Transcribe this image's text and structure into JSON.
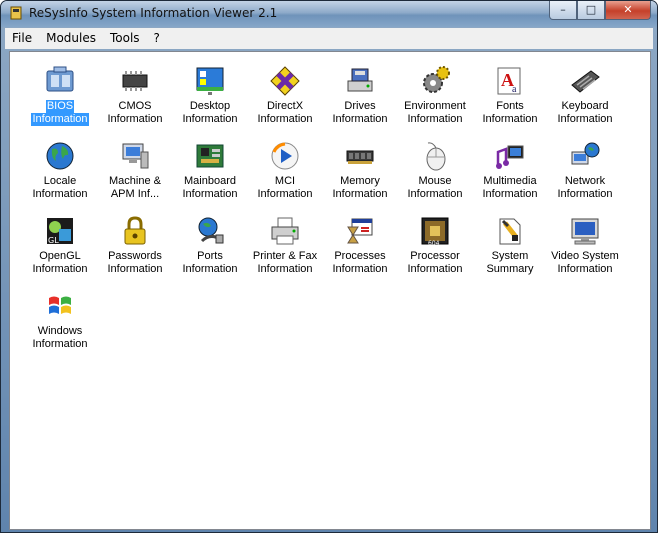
{
  "window": {
    "title": "ReSysInfo System Information Viewer 2.1",
    "minimize": "–",
    "maximize": "□",
    "close": "✕"
  },
  "menu": [
    "File",
    "Modules",
    "Tools",
    "?"
  ],
  "modules": [
    {
      "line1": "BIOS",
      "line2": "Information",
      "icon": "bios-icon"
    },
    {
      "line1": "CMOS",
      "line2": "Information",
      "icon": "chip-icon"
    },
    {
      "line1": "Desktop",
      "line2": "Information",
      "icon": "desktop-icon"
    },
    {
      "line1": "DirectX",
      "line2": "Information",
      "icon": "directx-icon"
    },
    {
      "line1": "Drives",
      "line2": "Information",
      "icon": "drives-icon"
    },
    {
      "line1": "Environment",
      "line2": "Information",
      "icon": "gears-icon"
    },
    {
      "line1": "Fonts",
      "line2": "Information",
      "icon": "fonts-icon"
    },
    {
      "line1": "Keyboard",
      "line2": "Information",
      "icon": "keyboard-icon"
    },
    {
      "line1": "Locale",
      "line2": "Information",
      "icon": "globe-icon"
    },
    {
      "line1": "Machine &",
      "line2": "APM Inf...",
      "icon": "computer-icon"
    },
    {
      "line1": "Mainboard",
      "line2": "Information",
      "icon": "mainboard-icon"
    },
    {
      "line1": "MCI",
      "line2": "Information",
      "icon": "media-player-icon"
    },
    {
      "line1": "Memory",
      "line2": "Information",
      "icon": "memory-icon"
    },
    {
      "line1": "Mouse",
      "line2": "Information",
      "icon": "mouse-icon"
    },
    {
      "line1": "Multimedia",
      "line2": "Information",
      "icon": "multimedia-icon"
    },
    {
      "line1": "Network",
      "line2": "Information",
      "icon": "network-icon"
    },
    {
      "line1": "OpenGL",
      "line2": "Information",
      "icon": "opengl-icon"
    },
    {
      "line1": "Passwords",
      "line2": "Information",
      "icon": "padlock-icon"
    },
    {
      "line1": "Ports",
      "line2": "Information",
      "icon": "ports-icon"
    },
    {
      "line1": "Printer & Fax",
      "line2": "Information",
      "icon": "printer-icon"
    },
    {
      "line1": "Processes",
      "line2": "Information",
      "icon": "processes-icon"
    },
    {
      "line1": "Processor",
      "line2": "Information",
      "icon": "processor-icon"
    },
    {
      "line1": "System",
      "line2": "Summary",
      "icon": "system-summary-icon"
    },
    {
      "line1": "Video System",
      "line2": "Information",
      "icon": "monitor-icon"
    },
    {
      "line1": "Windows",
      "line2": "Information",
      "icon": "windows-flag-icon"
    }
  ],
  "selected_index": 0,
  "colors": {
    "selection": "#3399ff",
    "titlebar": "#8eaac9",
    "menubar": "#f0f0f0"
  }
}
